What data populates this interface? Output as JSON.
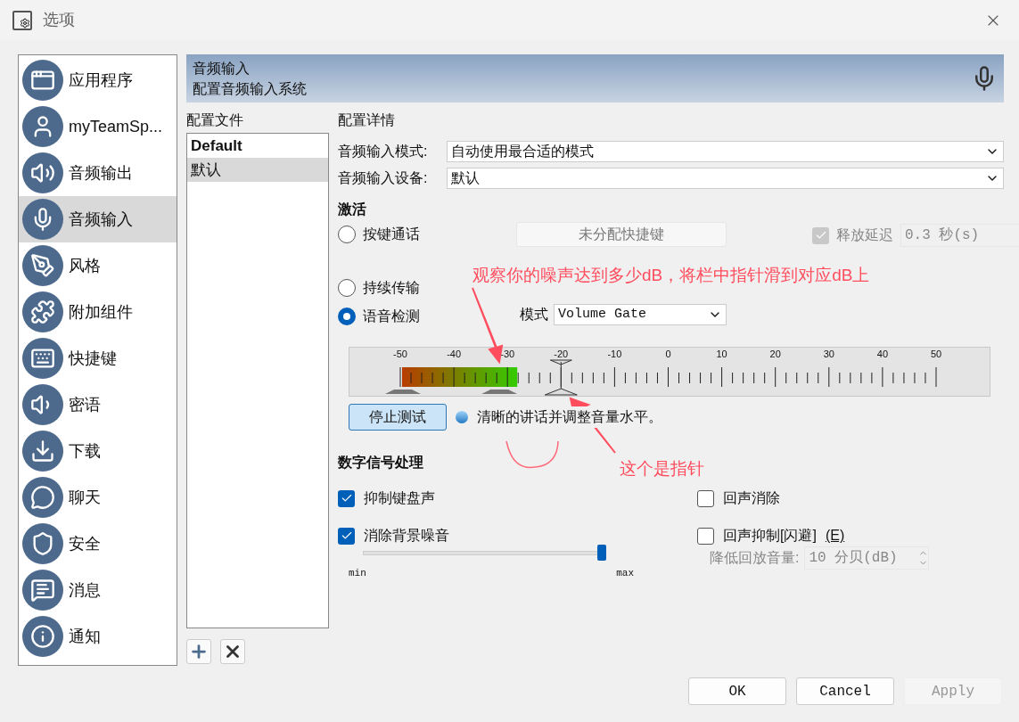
{
  "window": {
    "title": "选项"
  },
  "sidebar": {
    "items": [
      {
        "label": "应用程序",
        "selected": false
      },
      {
        "label": "myTeamSp...",
        "selected": false
      },
      {
        "label": "音频输出",
        "selected": false
      },
      {
        "label": "音频输入",
        "selected": true
      },
      {
        "label": "风格",
        "selected": false
      },
      {
        "label": "附加组件",
        "selected": false
      },
      {
        "label": "快捷键",
        "selected": false
      },
      {
        "label": "密语",
        "selected": false
      },
      {
        "label": "下载",
        "selected": false
      },
      {
        "label": "聊天",
        "selected": false
      },
      {
        "label": "安全",
        "selected": false
      },
      {
        "label": "消息",
        "selected": false
      },
      {
        "label": "通知",
        "selected": false
      }
    ]
  },
  "header": {
    "title": "音频输入",
    "subtitle": "配置音频输入系统"
  },
  "profiles": {
    "heading": "配置文件",
    "items": [
      {
        "label": "Default",
        "default": true,
        "selected": false
      },
      {
        "label": "默认",
        "default": false,
        "selected": true
      }
    ]
  },
  "details": {
    "heading": "配置详情",
    "fields": [
      {
        "label": "音频输入模式:",
        "value": "自动使用最合适的模式"
      },
      {
        "label": "音频输入设备:",
        "value": "默认"
      }
    ]
  },
  "activation": {
    "heading": "激活",
    "modes": [
      {
        "label": "按键通话",
        "selected": false
      },
      {
        "label": "持续传输",
        "selected": false
      },
      {
        "label": "语音检测",
        "selected": true
      }
    ],
    "hotkey_button": "未分配快捷键",
    "release_delay": {
      "label": "释放延迟",
      "checked": true,
      "disabled": true,
      "value": "0.3 秒(s)"
    },
    "mode_label": "模式",
    "mode_value": "Volume Gate",
    "meter": {
      "scale": [
        "-50",
        "-40",
        "-30",
        "-20",
        "-10",
        "0",
        "10",
        "20",
        "30",
        "40",
        "50"
      ],
      "level": 0.215,
      "pointer": {
        "level": 0.3
      }
    },
    "test_button": "停止测试",
    "hint": "清晰的讲话并调整音量水平。"
  },
  "dsp": {
    "heading": "数字信号处理",
    "options": [
      {
        "label": "抑制键盘声",
        "checked": true
      },
      {
        "label": "回声消除",
        "checked": false
      },
      {
        "label": "消除背景噪音",
        "checked": true
      },
      {
        "label": "回声抑制[闪避]",
        "mnemonic": "(E)",
        "checked": false
      }
    ],
    "noise_slider": {
      "level": 0.985,
      "min": "min",
      "max": "max"
    },
    "ducking": {
      "label": "降低回放音量:",
      "value": "10 分贝(dB)",
      "disabled": true
    }
  },
  "buttons": [
    {
      "label": "OK",
      "disabled": false
    },
    {
      "label": "Cancel",
      "disabled": false
    },
    {
      "label": "Apply",
      "disabled": true
    }
  ],
  "annotations": [
    {
      "text": "观察你的噪声达到多少dB，将栏中指针滑到对应dB上"
    },
    {
      "text": "这个是指针"
    }
  ]
}
